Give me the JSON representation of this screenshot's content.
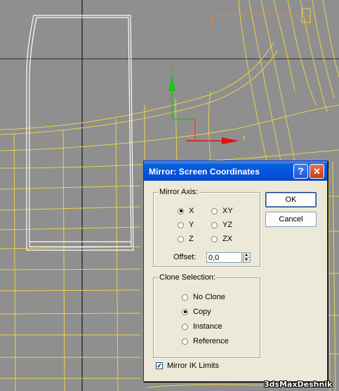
{
  "dialog": {
    "title": "Mirror: Screen Coordinates",
    "help_glyph": "?",
    "close_glyph": "✕",
    "mirror_axis": {
      "label": "Mirror Axis:",
      "options": [
        {
          "label": "X",
          "checked": true
        },
        {
          "label": "XY",
          "checked": false
        },
        {
          "label": "Y",
          "checked": false
        },
        {
          "label": "YZ",
          "checked": false
        },
        {
          "label": "Z",
          "checked": false
        },
        {
          "label": "ZX",
          "checked": false
        }
      ],
      "offset_label": "Offset:",
      "offset_value": "0,0"
    },
    "clone_selection": {
      "label": "Clone Selection:",
      "options": [
        {
          "label": "No Clone",
          "checked": false
        },
        {
          "label": "Copy",
          "checked": true
        },
        {
          "label": "Instance",
          "checked": false
        },
        {
          "label": "Reference",
          "checked": false
        }
      ]
    },
    "mirror_ik": {
      "label": "Mirror IK Limits",
      "checked": true
    },
    "ok_label": "OK",
    "cancel_label": "Cancel"
  },
  "viewport": {
    "gizmo_y_label": "y",
    "gizmo_x_label": "x",
    "colors": {
      "background": "#8f8f8f",
      "wireframe": "#e8d44a",
      "selected_object": "#ffffff",
      "gizmo_y": "#19c619",
      "gizmo_x": "#e01010"
    }
  },
  "watermark": "3dsMaxDeshnik"
}
